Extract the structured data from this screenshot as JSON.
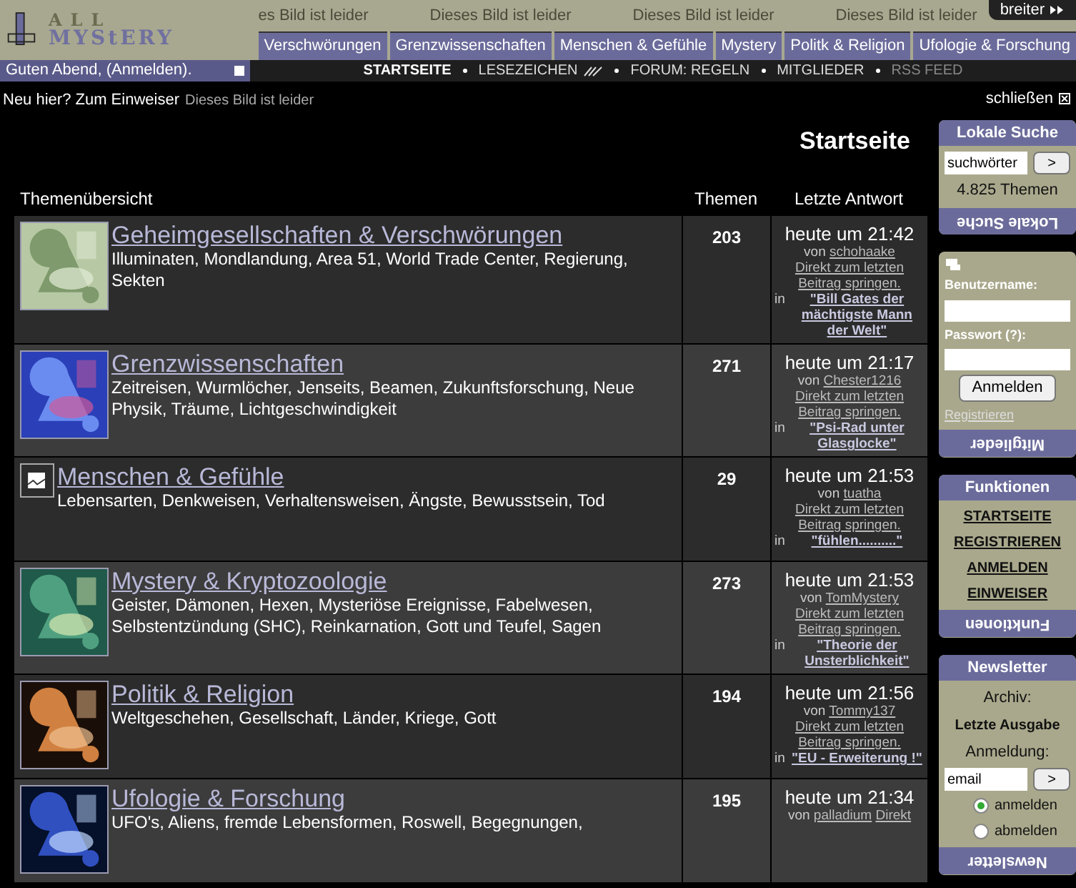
{
  "header": {
    "logo": [
      "ALL",
      "MYStERY"
    ],
    "broken_images": [
      "es Bild ist leider",
      "Dieses Bild ist leider",
      "Dieses Bild ist leider",
      "Dieses Bild ist leider"
    ],
    "wide_button": "breiter",
    "tabs": [
      "Verschwörungen",
      "Grenzwissenschaften",
      "Menschen & Gefühle",
      "Mystery",
      "Politk & Religion",
      "Ufologie & Forschung"
    ],
    "greeting": "Guten Abend, (Anmelden).",
    "nav": [
      {
        "label": "STARTSEITE",
        "selected": true,
        "muted": false
      },
      {
        "label": "LESEZEICHEN",
        "selected": false,
        "muted": false
      },
      {
        "label": "FORUM: REGELN",
        "selected": false,
        "muted": false
      },
      {
        "label": "MITGLIEDER",
        "selected": false,
        "muted": false
      },
      {
        "label": "RSS FEED",
        "selected": false,
        "muted": true
      }
    ]
  },
  "intro": {
    "text": "Neu hier? Zum Einweiser",
    "broken_image": "Dieses Bild ist leider",
    "close": "schließen"
  },
  "page_title": "Startseite",
  "table": {
    "columns": [
      "Themenübersicht",
      "Themen",
      "Letzte Antwort"
    ],
    "rows": [
      {
        "kind": "picture",
        "title": "Geheimgesellschaften & Verschwörungen",
        "description": "Illuminaten, Mondlandung, Area 51, World Trade Center, Regierung, Sekten",
        "topics": "203",
        "time": "heute um 21:42",
        "by": "von",
        "user": "schohaake",
        "jump": "Direkt zum letzten Beitrag springen.",
        "in": "in",
        "thread": "\"Bill Gates der mächtigste Mann der Welt\""
      },
      {
        "kind": "picture",
        "title": "Grenzwissenschaften",
        "description": "Zeitreisen, Wurmlöcher, Jenseits, Beamen, Zukunftsforschung, Neue Physik, Träume, Lichtgeschwindigkeit",
        "topics": "271",
        "time": "heute um 21:17",
        "by": "von",
        "user": "Chester1216",
        "jump": "Direkt zum letzten Beitrag springen.",
        "in": "in",
        "thread": "\"Psi-Rad unter Glasglocke\""
      },
      {
        "kind": "broken",
        "title": "Menschen & Gefühle",
        "description": "Lebensarten, Denkweisen, Verhaltensweisen, Ängste, Bewusstsein, Tod",
        "topics": "29",
        "time": "heute um 21:53",
        "by": "von",
        "user": "tuatha",
        "jump": "Direkt zum letzten Beitrag springen.",
        "in": "in",
        "thread": "\"fühlen..........\""
      },
      {
        "kind": "picture",
        "title": "Mystery & Kryptozoologie",
        "description": "Geister, Dämonen, Hexen, Mysteriöse Ereignisse, Fabelwesen, Selbstentzündung (SHC), Reinkarnation, Gott und Teufel, Sagen",
        "topics": "273",
        "time": "heute um 21:53",
        "by": "von",
        "user": "TomMystery",
        "jump": "Direkt zum letzten Beitrag springen.",
        "in": "in",
        "thread": "\"Theorie der Unsterblichkeit\""
      },
      {
        "kind": "picture",
        "title": "Politik & Religion",
        "description": "Weltgeschehen, Gesellschaft, Länder, Kriege, Gott",
        "topics": "194",
        "time": "heute um 21:56",
        "by": "von",
        "user": "Tommy137",
        "jump": "Direkt zum letzten Beitrag springen.",
        "in": "in",
        "thread": "\"EU - Erweiterung !\""
      },
      {
        "kind": "picture",
        "title": "Ufologie & Forschung",
        "description": "UFO's, Aliens, fremde Lebensformen, Roswell, Begegnungen,",
        "topics": "195",
        "time": "heute um 21:34",
        "by": "von",
        "user": "palladium",
        "jump": "Direkt"
      }
    ]
  },
  "sidebar": {
    "search": {
      "title": "Lokale Suche",
      "value": "suchwörter",
      "button": ">",
      "count": "4.825 Themen",
      "footer": "Lokale Suche"
    },
    "members": {
      "username_label": "Benutzername:",
      "password_label": "Passwort (?):",
      "button": "Anmelden",
      "register": "Registrieren",
      "footer": "Mitglieder"
    },
    "functions": {
      "title": "Funktionen",
      "links": [
        "STARTSEITE",
        "REGISTRIEREN",
        "ANMELDEN",
        "EINWEISER"
      ],
      "footer": "Funktionen"
    },
    "newsletter": {
      "title": "Newsletter",
      "archive_label": "Archiv:",
      "archive_link": "Letzte Ausgabe",
      "signup_label": "Anmeldung:",
      "value": "email",
      "button": ">",
      "options": [
        {
          "label": "anmelden",
          "selected": true
        },
        {
          "label": "abmelden",
          "selected": false
        }
      ],
      "footer": "Newsletter"
    }
  }
}
